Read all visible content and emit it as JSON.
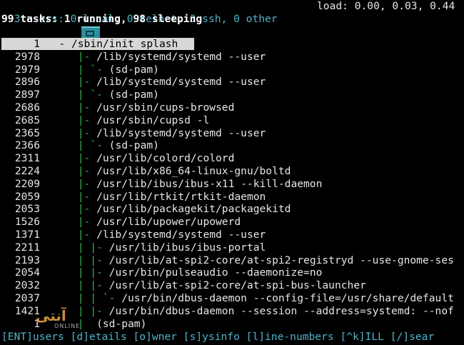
{
  "header": {
    "users_line": "3 users: 0 local, 0 telnet, 3 ssh, 0 other",
    "load_line": "load: 0.00, 0.03, 0.44",
    "tasks_line": "99 tasks: 1 running, 98 sleeping"
  },
  "processes": [
    {
      "pid": "1",
      "tree": "- ",
      "cmd": "/sbin/init splash",
      "selected": true
    },
    {
      "pid": "2978",
      "tree": "|- ",
      "cmd": "/lib/systemd/systemd --user"
    },
    {
      "pid": "2979",
      "tree": "| `- ",
      "cmd": "(sd-pam)"
    },
    {
      "pid": "2896",
      "tree": "|- ",
      "cmd": "/lib/systemd/systemd --user"
    },
    {
      "pid": "2897",
      "tree": "| `- ",
      "cmd": "(sd-pam)"
    },
    {
      "pid": "2686",
      "tree": "|- ",
      "cmd": "/usr/sbin/cups-browsed"
    },
    {
      "pid": "2685",
      "tree": "|- ",
      "cmd": "/usr/sbin/cupsd -l"
    },
    {
      "pid": "2365",
      "tree": "|- ",
      "cmd": "/lib/systemd/systemd --user"
    },
    {
      "pid": "2366",
      "tree": "| `- ",
      "cmd": "(sd-pam)"
    },
    {
      "pid": "2311",
      "tree": "|- ",
      "cmd": "/usr/lib/colord/colord"
    },
    {
      "pid": "2224",
      "tree": "|- ",
      "cmd": "/usr/lib/x86_64-linux-gnu/boltd"
    },
    {
      "pid": "2209",
      "tree": "|- ",
      "cmd": "/usr/lib/ibus/ibus-x11 --kill-daemon"
    },
    {
      "pid": "2059",
      "tree": "|- ",
      "cmd": "/usr/lib/rtkit/rtkit-daemon"
    },
    {
      "pid": "2053",
      "tree": "|- ",
      "cmd": "/usr/lib/packagekit/packagekitd"
    },
    {
      "pid": "1526",
      "tree": "|- ",
      "cmd": "/usr/lib/upower/upowerd"
    },
    {
      "pid": "1371",
      "tree": "|- ",
      "cmd": "/lib/systemd/systemd --user"
    },
    {
      "pid": "2211",
      "tree": "| |- ",
      "cmd": "/usr/lib/ibus/ibus-portal"
    },
    {
      "pid": "2193",
      "tree": "| |- ",
      "cmd": "/usr/lib/at-spi2-core/at-spi2-registryd --use-gnome-ses"
    },
    {
      "pid": "2054",
      "tree": "| |- ",
      "cmd": "/usr/bin/pulseaudio --daemonize=no"
    },
    {
      "pid": "2032",
      "tree": "| |- ",
      "cmd": "/usr/lib/at-spi2-core/at-spi-bus-launcher"
    },
    {
      "pid": "2037",
      "tree": "| | `- ",
      "cmd": "/usr/bin/dbus-daemon --config-file=/usr/share/default"
    },
    {
      "pid": "1421",
      "tree": "| |- ",
      "cmd": "/usr/bin/dbus-daemon --session --address=systemd: --nof"
    },
    {
      "pid": "1",
      "tree": "|  ",
      "cmd": "(sd-pam)"
    }
  ],
  "footer": {
    "keys": "[ENT]users [d]etails [o]wner [s]ysinfo [l]ine-numbers [^k]ILL [/]sear"
  },
  "watermark": {
    "text": "آنتی",
    "sub": "ONLINE"
  },
  "colors": {
    "background": "#000000",
    "header_cyan": "#4fb3c9",
    "tree_green": "#3ab54a",
    "selection_bg": "#d7d7d7"
  }
}
